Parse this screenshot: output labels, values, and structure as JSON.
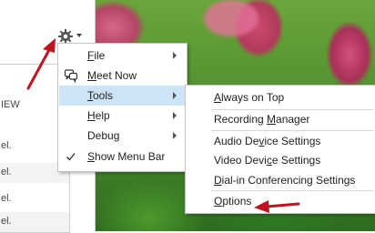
{
  "left_panel": {
    "header_fragment": "IEW",
    "rows": [
      "el.",
      "el.",
      "el.",
      "el."
    ]
  },
  "settings_menu": {
    "items": [
      {
        "pre": "",
        "key": "F",
        "post": "ile",
        "submenu": true
      },
      {
        "pre": "",
        "key": "M",
        "post": "eet Now",
        "submenu": false,
        "icon": "meet-now-icon"
      },
      {
        "pre": "",
        "key": "T",
        "post": "ools",
        "submenu": true,
        "highlighted": true
      },
      {
        "pre": "",
        "key": "H",
        "post": "elp",
        "submenu": true
      },
      {
        "pre": "Debug",
        "key": "",
        "post": "",
        "submenu": true
      },
      {
        "pre": "",
        "key": "S",
        "post": "how Menu Bar",
        "submenu": false,
        "checked": true
      }
    ]
  },
  "tools_menu": {
    "items": [
      {
        "pre": "",
        "key": "A",
        "post": "lways on Top"
      },
      {
        "pre": "Recording ",
        "key": "M",
        "post": "anager"
      },
      {
        "pre": "Audio De",
        "key": "v",
        "post": "ice Settings"
      },
      {
        "pre": "Video Devi",
        "key": "c",
        "post": "e Settings"
      },
      {
        "pre": "",
        "key": "D",
        "post": "ial-in Conferencing Settings"
      },
      {
        "pre": "",
        "key": "O",
        "post": "ptions"
      }
    ]
  },
  "colors": {
    "menu_highlight": "#cde4f7",
    "annotation_arrow": "#c1121f"
  }
}
